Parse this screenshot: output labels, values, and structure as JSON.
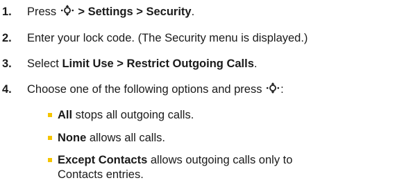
{
  "steps": [
    {
      "number": "1.",
      "pre": "Press",
      "bold": "> Settings > Security",
      "post": "."
    },
    {
      "number": "2.",
      "text": "Enter your lock code. (The Security menu is displayed.)"
    },
    {
      "number": "3.",
      "pre": "Select ",
      "bold": "Limit Use > Restrict Outgoing Calls",
      "post": "."
    },
    {
      "number": "4.",
      "pre": "Choose one of the following options and press",
      "post": ":"
    }
  ],
  "options": [
    {
      "bold": "All",
      "rest": " stops all outgoing calls."
    },
    {
      "bold": "None",
      "rest": " allows all calls."
    },
    {
      "bold": "Except Contacts",
      "rest": " allows outgoing calls only to",
      "line2": "Contacts entries."
    }
  ],
  "colors": {
    "text": "#1a1a1a",
    "bullet": "#f5c400"
  },
  "icons": {
    "navigation": "navigation-key-icon"
  }
}
